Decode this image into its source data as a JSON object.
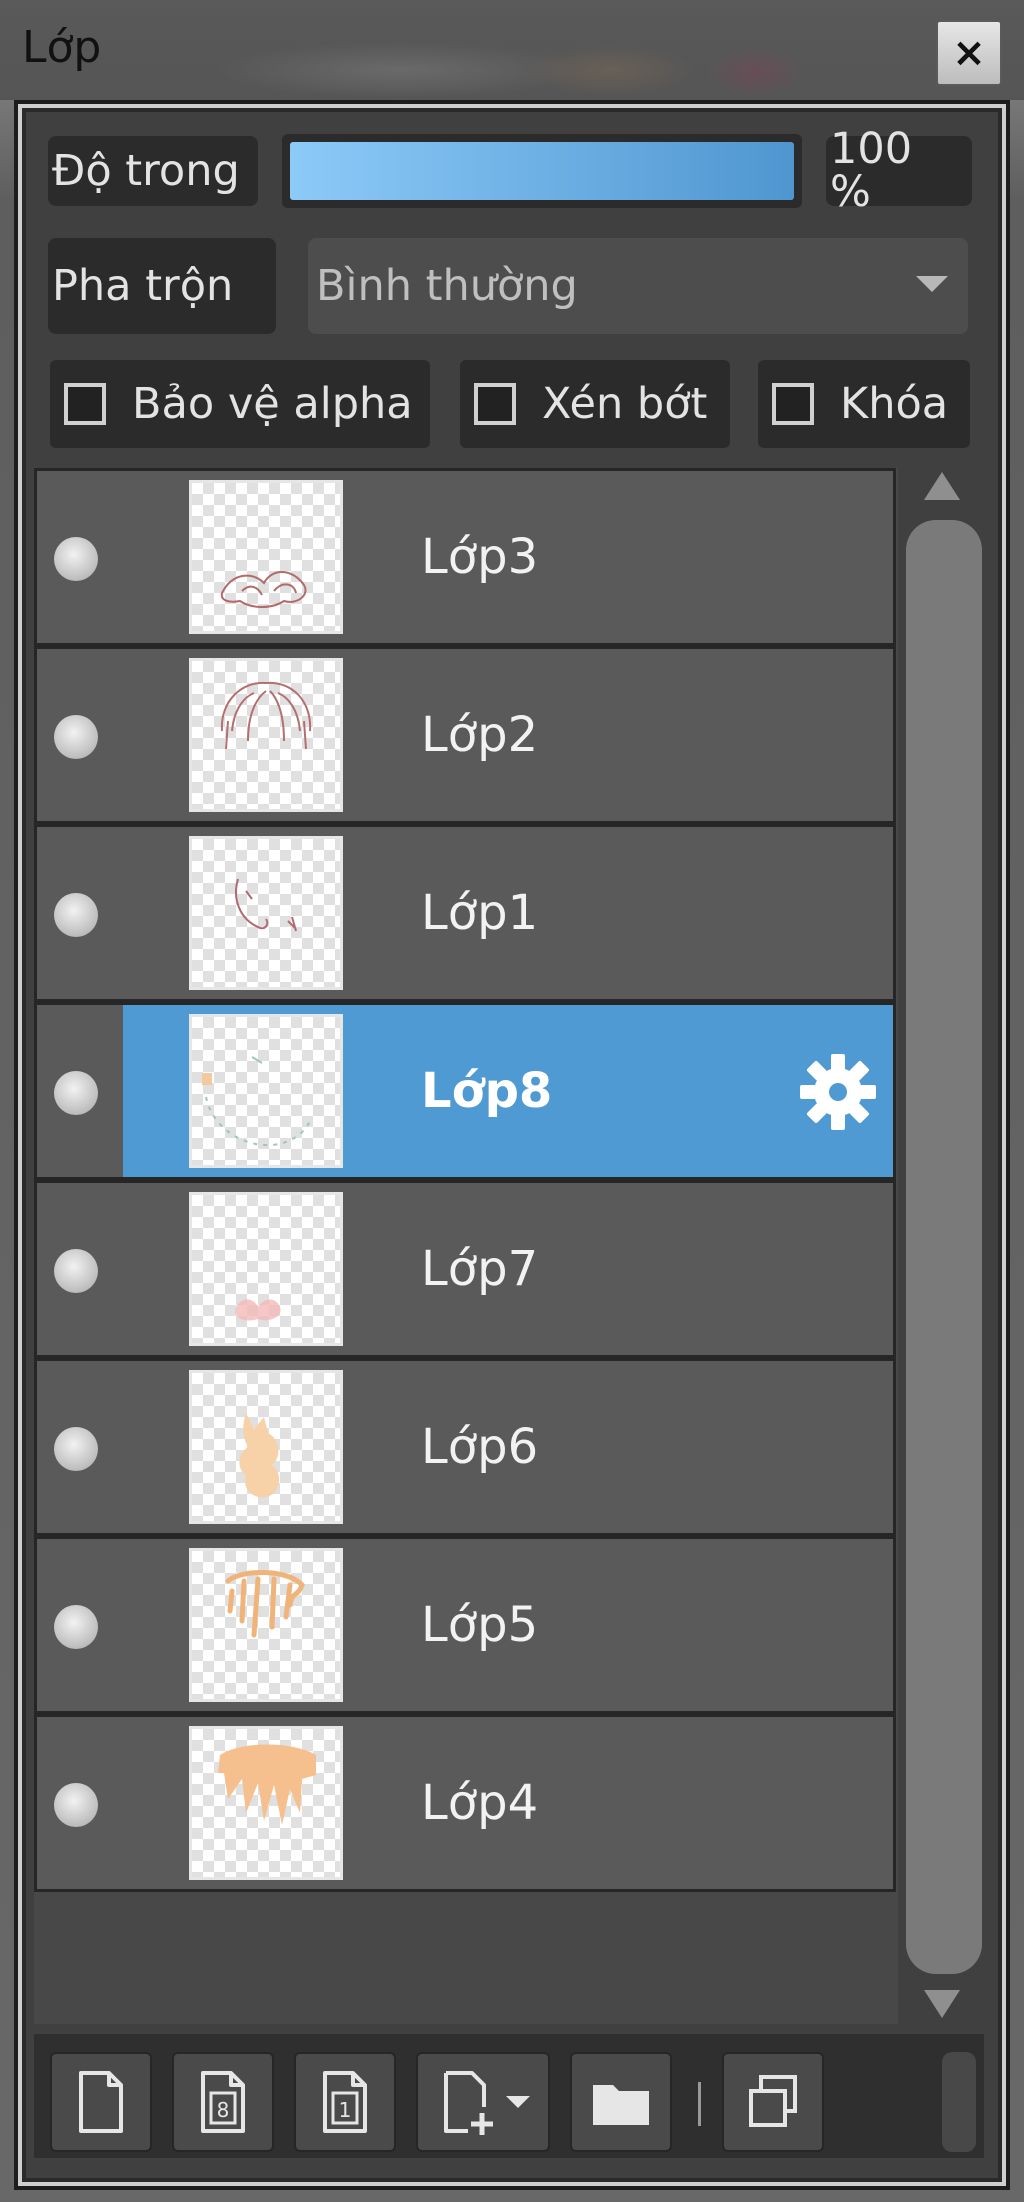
{
  "window": {
    "title": "Lớp",
    "close_glyph": "×"
  },
  "opacity": {
    "label": "Độ trong",
    "value_text": "100 %",
    "value": 1.0
  },
  "blend": {
    "label": "Pha trộn",
    "selected": "Bình thường"
  },
  "options": [
    {
      "label": "Bảo vệ alpha",
      "checked": false
    },
    {
      "label": "Xén bớt",
      "checked": false
    },
    {
      "label": "Khóa",
      "checked": false
    }
  ],
  "layers": [
    {
      "name": "Lớp3",
      "selected": false
    },
    {
      "name": "Lớp2",
      "selected": false
    },
    {
      "name": "Lớp1",
      "selected": false
    },
    {
      "name": "Lớp8",
      "selected": true
    },
    {
      "name": "Lớp7",
      "selected": false
    },
    {
      "name": "Lớp6",
      "selected": false
    },
    {
      "name": "Lớp5",
      "selected": false
    },
    {
      "name": "Lớp4",
      "selected": false
    }
  ],
  "toolbar": [
    {
      "icon": "new-layer-icon"
    },
    {
      "icon": "new-8bit-layer-icon"
    },
    {
      "icon": "new-1bit-layer-icon"
    },
    {
      "icon": "add-layer-dropdown-icon"
    },
    {
      "icon": "folder-icon"
    },
    {
      "icon": "duplicate-layer-icon"
    }
  ],
  "colors": {
    "accent": "#4f9ad2",
    "panel": "#404040",
    "row": "#5a5a5a"
  }
}
